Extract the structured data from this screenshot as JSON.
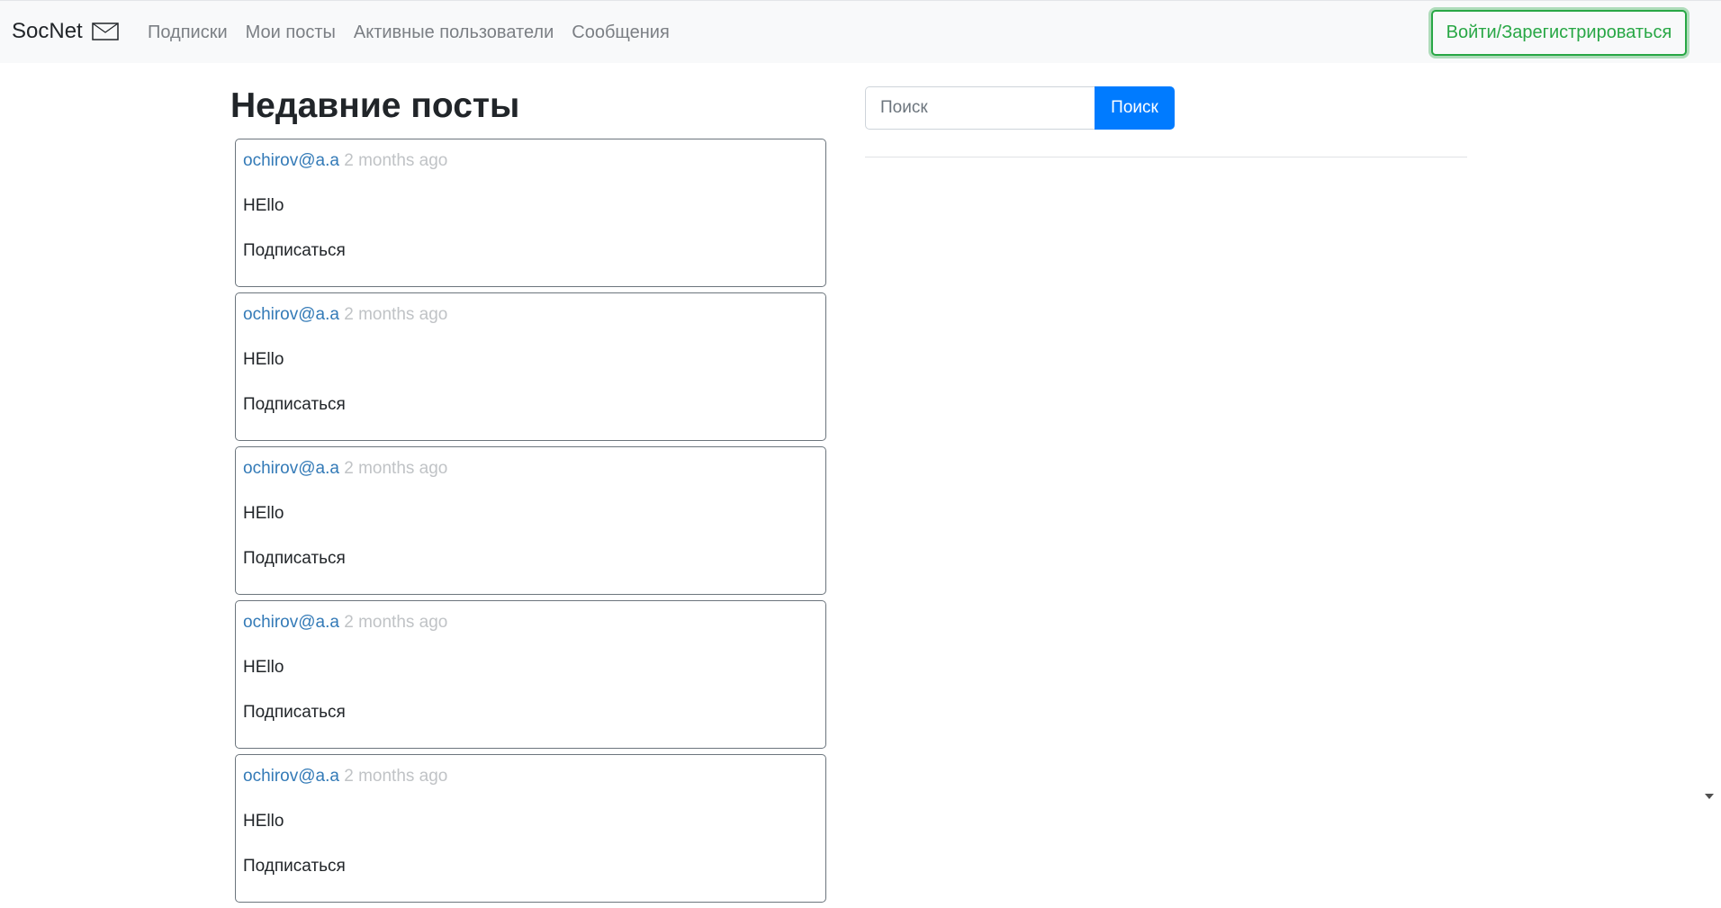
{
  "navbar": {
    "brand": "SocNet",
    "brand_icon": "envelope-icon",
    "links": [
      {
        "label": "Подписки"
      },
      {
        "label": "Мои посты"
      },
      {
        "label": "Активные пользователи"
      },
      {
        "label": "Сообщения"
      }
    ],
    "login_label": "Войти/Зарегистрироваться"
  },
  "main": {
    "title": "Недавние посты",
    "posts": [
      {
        "author": "ochirov@a.a",
        "time": "2 months ago",
        "text": "HEllo",
        "follow": "Подписаться"
      },
      {
        "author": "ochirov@a.a",
        "time": "2 months ago",
        "text": "HEllo",
        "follow": "Подписаться"
      },
      {
        "author": "ochirov@a.a",
        "time": "2 months ago",
        "text": "HEllo",
        "follow": "Подписаться"
      },
      {
        "author": "ochirov@a.a",
        "time": "2 months ago",
        "text": "HEllo",
        "follow": "Подписаться"
      },
      {
        "author": "ochirov@a.a",
        "time": "2 months ago",
        "text": "HEllo",
        "follow": "Подписаться"
      }
    ]
  },
  "search": {
    "placeholder": "Поиск",
    "value": "",
    "button_label": "Поиск"
  },
  "colors": {
    "navbar_bg": "#f8f9fa",
    "link": "#337ab7",
    "accent_green": "#28a745",
    "primary_blue": "#007bff"
  }
}
